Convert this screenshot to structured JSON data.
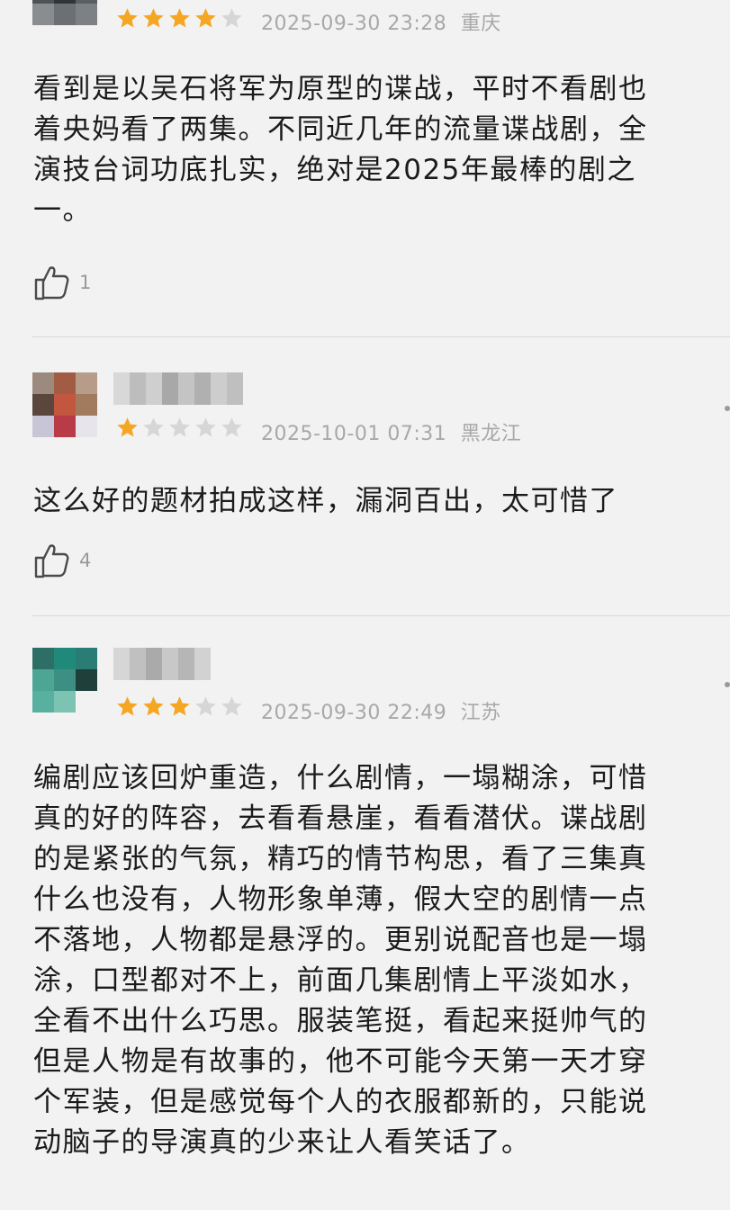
{
  "reviews": [
    {
      "stars": 4,
      "date": "2025-09-30 23:28",
      "region": "重庆",
      "lines": [
        "看到是以吴石将军为原型的谍战，平时不看剧也",
        "着央妈看了两集。不同近几年的流量谍战剧，全",
        "演技台词功底扎实，绝对是2025年最棒的剧之",
        "一。"
      ],
      "likes": "1"
    },
    {
      "stars": 1,
      "date": "2025-10-01 07:31",
      "region": "黑龙江",
      "lines": [
        "这么好的题材拍成这样，漏洞百出，太可惜了"
      ],
      "likes": "4"
    },
    {
      "stars": 3,
      "date": "2025-09-30 22:49",
      "region": "江苏",
      "lines": [
        "编剧应该回炉重造，什么剧情，一塌糊涂，可惜",
        "真的好的阵容，去看看悬崖，看看潜伏。谍战剧",
        "的是紧张的气氛，精巧的情节构思，看了三集真",
        "什么也没有，人物形象单薄，假大空的剧情一点",
        "不落地，人物都是悬浮的。更别说配音也是一塌",
        "涂，口型都对不上，前面几集剧情上平淡如水，",
        "全看不出什么巧思。服装笔挺，看起来挺帅气的",
        "但是人物是有故事的，他不可能今天第一天才穿",
        "个军装，但是感觉每个人的衣服都新的，只能说",
        "动脑子的导演真的少来让人看笑话了。"
      ],
      "likes": ""
    }
  ],
  "colors": {
    "star_filled": "#f5a623",
    "star_empty": "#d6d6d6",
    "meta_text": "#a8a8a8",
    "background": "#f2f2f2"
  },
  "icons": {
    "like": "thumbs-up-icon",
    "more": "more-dots-icon"
  }
}
